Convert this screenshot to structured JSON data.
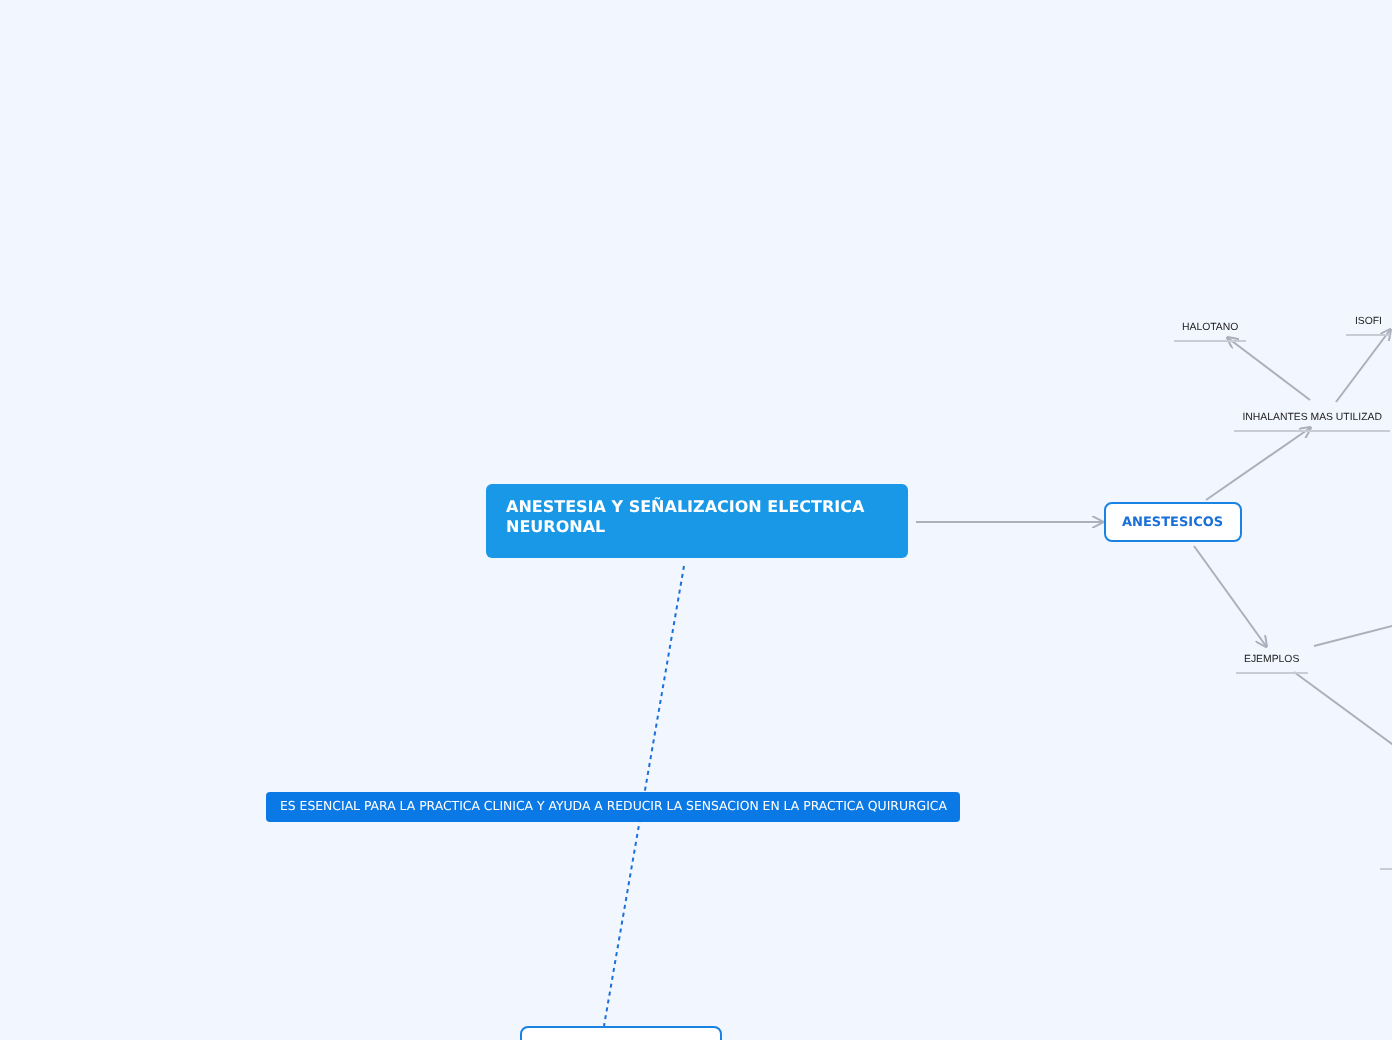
{
  "central_topic": {
    "title": "ANESTESIA Y SEÑALIZACION ELECTRICA NEURONAL"
  },
  "topics": [
    {
      "kind": "boxed",
      "label": "ANESTESICOS"
    },
    {
      "kind": "plain",
      "label": "INHALANTES MAS UTILIZAD"
    },
    {
      "kind": "plain",
      "label": "HALOTANO"
    },
    {
      "kind": "plain",
      "label": "ISOFI"
    },
    {
      "kind": "plain",
      "label": "EJEMPLOS"
    },
    {
      "kind": "filled",
      "label": "ES ESENCIAL PARA LA PRACTICA CLINICA Y AYUDA A REDUCIR LA SENSACION EN LA PRACTICA QUIRURGICA"
    }
  ]
}
